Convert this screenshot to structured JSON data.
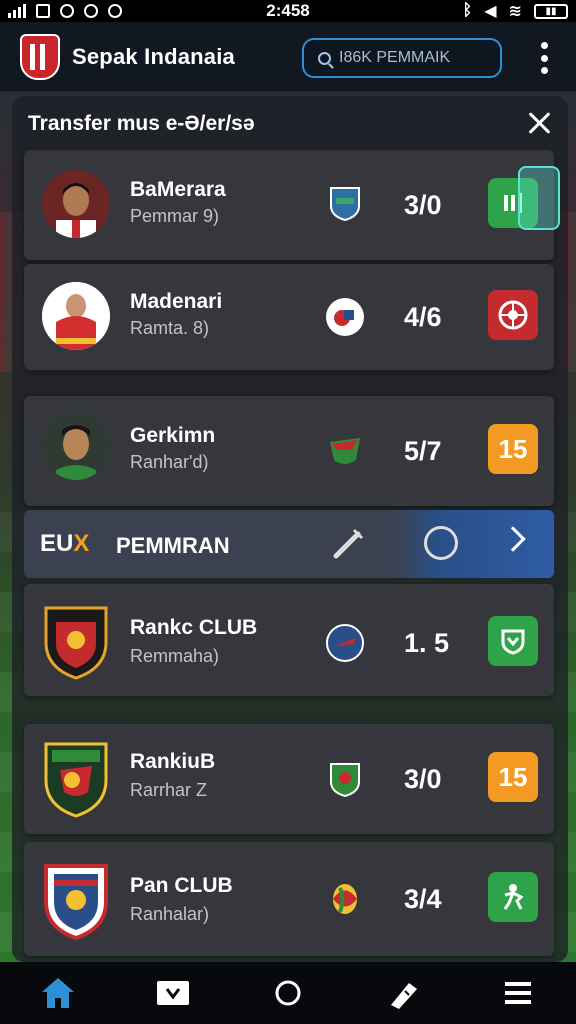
{
  "statusbar": {
    "time": "2:458"
  },
  "header": {
    "title": "Sepak Indanaia",
    "search_placeholder": "I86K PEMMAIK"
  },
  "panel": {
    "title": "Transfer mus e-Ə/er/sə"
  },
  "colors": {
    "accent": "#2d8fd6",
    "green": "#2fa34a",
    "red": "#c52a2f",
    "orange": "#f39a22"
  },
  "rows": [
    {
      "name": "BaMerara",
      "sub": "Pemmar 9)",
      "score": "3/0",
      "badge_label": "",
      "badge_icon": "boot-icon"
    },
    {
      "name": "Madenari",
      "sub": "Ramta. 8)",
      "score": "4/6",
      "badge_label": "",
      "badge_icon": "ball-icon"
    },
    {
      "name": "Gerkimn",
      "sub": "Ranhar'd)",
      "score": "5/7",
      "badge_label": "15",
      "badge_icon": ""
    },
    {
      "name": "Rankc CLUB",
      "sub": "Remmaha)",
      "score": "1. 5",
      "badge_label": "",
      "badge_icon": "shield-icon"
    },
    {
      "name": "RankiuB",
      "sub": "Rarrhar Z",
      "score": "3/0",
      "badge_label": "15",
      "badge_icon": ""
    },
    {
      "name": "Pan CLUB",
      "sub": "Ranhalar)",
      "score": "3/4",
      "badge_label": "",
      "badge_icon": "player-icon"
    }
  ],
  "banner": {
    "logo_left": "EU",
    "logo_accent": "X",
    "text": "PEMMRAN"
  },
  "bottomnav": [
    "home",
    "inbox",
    "circle",
    "boot",
    "menu"
  ]
}
